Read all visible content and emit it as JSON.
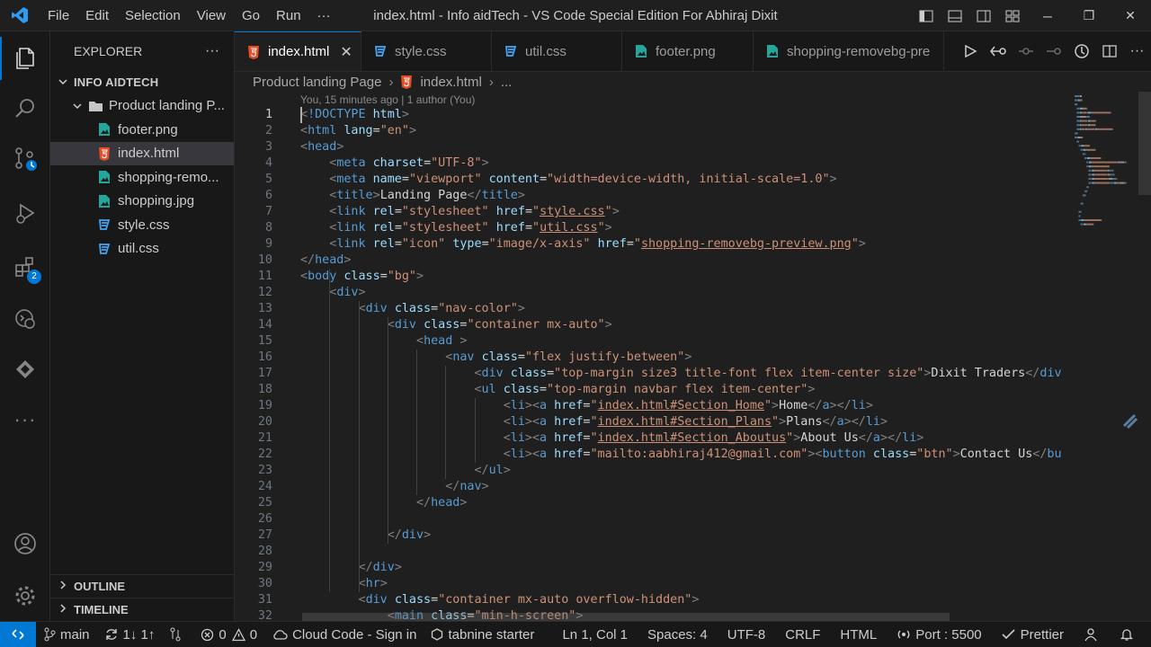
{
  "titlebar": {
    "menu": [
      "File",
      "Edit",
      "Selection",
      "View",
      "Go",
      "Run",
      "···"
    ],
    "title": "index.html - Info aidTech - VS Code Special Edition For Abhiraj Dixit"
  },
  "activitybar": {
    "scm_badge": "",
    "ext_badge": "2"
  },
  "sidebar": {
    "header": "EXPLORER",
    "more": "···",
    "project": "INFO AIDTECH",
    "folder": "Product landing P...",
    "files": [
      "footer.png",
      "index.html",
      "shopping-remo...",
      "shopping.jpg",
      "style.css",
      "util.css"
    ],
    "outline": "OUTLINE",
    "timeline": "TIMELINE"
  },
  "tabs": [
    {
      "label": "index.html",
      "close": "✕"
    },
    {
      "label": "style.css"
    },
    {
      "label": "util.css"
    },
    {
      "label": "footer.png"
    },
    {
      "label": "shopping-removebg-pre"
    }
  ],
  "breadcrumb": {
    "folder": "Product landing Page",
    "file": "index.html",
    "more": "..."
  },
  "codelens": "You, 15 minutes ago | 1 author (You)",
  "code_lines": [
    {
      "n": "1",
      "tokens": [
        [
          "t-br",
          "<"
        ],
        [
          "t-tag",
          "!DOCTYPE"
        ],
        [
          "t-txt",
          " "
        ],
        [
          "t-attr",
          "html"
        ],
        [
          "t-br",
          ">"
        ]
      ]
    },
    {
      "n": "2",
      "tokens": [
        [
          "t-br",
          "<"
        ],
        [
          "t-tag",
          "html"
        ],
        [
          "t-txt",
          " "
        ],
        [
          "t-attr",
          "lang"
        ],
        [
          "t-txt",
          "="
        ],
        [
          "t-str",
          "\"en\""
        ],
        [
          "t-br",
          ">"
        ]
      ]
    },
    {
      "n": "3",
      "tokens": [
        [
          "t-br",
          "<"
        ],
        [
          "t-tag",
          "head"
        ],
        [
          "t-br",
          ">"
        ]
      ]
    },
    {
      "n": "4",
      "tokens": [
        [
          "t-txt",
          "    "
        ],
        [
          "t-br",
          "<"
        ],
        [
          "t-tag",
          "meta"
        ],
        [
          "t-txt",
          " "
        ],
        [
          "t-attr",
          "charset"
        ],
        [
          "t-txt",
          "="
        ],
        [
          "t-str",
          "\"UTF-8\""
        ],
        [
          "t-br",
          ">"
        ]
      ]
    },
    {
      "n": "5",
      "tokens": [
        [
          "t-txt",
          "    "
        ],
        [
          "t-br",
          "<"
        ],
        [
          "t-tag",
          "meta"
        ],
        [
          "t-txt",
          " "
        ],
        [
          "t-attr",
          "name"
        ],
        [
          "t-txt",
          "="
        ],
        [
          "t-str",
          "\"viewport\""
        ],
        [
          "t-txt",
          " "
        ],
        [
          "t-attr",
          "content"
        ],
        [
          "t-txt",
          "="
        ],
        [
          "t-str",
          "\"width=device-width, initial-scale=1.0\""
        ],
        [
          "t-br",
          ">"
        ]
      ]
    },
    {
      "n": "6",
      "tokens": [
        [
          "t-txt",
          "    "
        ],
        [
          "t-br",
          "<"
        ],
        [
          "t-tag",
          "title"
        ],
        [
          "t-br",
          ">"
        ],
        [
          "t-txt",
          "Landing Page"
        ],
        [
          "t-br",
          "</"
        ],
        [
          "t-tag",
          "title"
        ],
        [
          "t-br",
          ">"
        ]
      ]
    },
    {
      "n": "7",
      "tokens": [
        [
          "t-txt",
          "    "
        ],
        [
          "t-br",
          "<"
        ],
        [
          "t-tag",
          "link"
        ],
        [
          "t-txt",
          " "
        ],
        [
          "t-attr",
          "rel"
        ],
        [
          "t-txt",
          "="
        ],
        [
          "t-str",
          "\"stylesheet\""
        ],
        [
          "t-txt",
          " "
        ],
        [
          "t-attr",
          "href"
        ],
        [
          "t-txt",
          "="
        ],
        [
          "t-str",
          "\""
        ],
        [
          "t-url",
          "style.css"
        ],
        [
          "t-str",
          "\""
        ],
        [
          "t-br",
          ">"
        ]
      ]
    },
    {
      "n": "8",
      "tokens": [
        [
          "t-txt",
          "    "
        ],
        [
          "t-br",
          "<"
        ],
        [
          "t-tag",
          "link"
        ],
        [
          "t-txt",
          " "
        ],
        [
          "t-attr",
          "rel"
        ],
        [
          "t-txt",
          "="
        ],
        [
          "t-str",
          "\"stylesheet\""
        ],
        [
          "t-txt",
          " "
        ],
        [
          "t-attr",
          "href"
        ],
        [
          "t-txt",
          "="
        ],
        [
          "t-str",
          "\""
        ],
        [
          "t-url",
          "util.css"
        ],
        [
          "t-str",
          "\""
        ],
        [
          "t-br",
          ">"
        ]
      ]
    },
    {
      "n": "9",
      "tokens": [
        [
          "t-txt",
          "    "
        ],
        [
          "t-br",
          "<"
        ],
        [
          "t-tag",
          "link"
        ],
        [
          "t-txt",
          " "
        ],
        [
          "t-attr",
          "rel"
        ],
        [
          "t-txt",
          "="
        ],
        [
          "t-str",
          "\"icon\""
        ],
        [
          "t-txt",
          " "
        ],
        [
          "t-attr",
          "type"
        ],
        [
          "t-txt",
          "="
        ],
        [
          "t-str",
          "\"image/x-axis\""
        ],
        [
          "t-txt",
          " "
        ],
        [
          "t-attr",
          "href"
        ],
        [
          "t-txt",
          "="
        ],
        [
          "t-str",
          "\""
        ],
        [
          "t-url",
          "shopping-removebg-preview.png"
        ],
        [
          "t-str",
          "\""
        ],
        [
          "t-br",
          ">"
        ]
      ]
    },
    {
      "n": "10",
      "tokens": [
        [
          "t-br",
          "</"
        ],
        [
          "t-tag",
          "head"
        ],
        [
          "t-br",
          ">"
        ]
      ]
    },
    {
      "n": "11",
      "tokens": [
        [
          "t-br",
          "<"
        ],
        [
          "t-tag",
          "body"
        ],
        [
          "t-txt",
          " "
        ],
        [
          "t-attr",
          "class"
        ],
        [
          "t-txt",
          "="
        ],
        [
          "t-str",
          "\"bg\""
        ],
        [
          "t-br",
          ">"
        ]
      ]
    },
    {
      "n": "12",
      "tokens": [
        [
          "t-txt",
          "    "
        ],
        [
          "t-br",
          "<"
        ],
        [
          "t-tag",
          "div"
        ],
        [
          "t-br",
          ">"
        ]
      ]
    },
    {
      "n": "13",
      "tokens": [
        [
          "t-txt",
          "        "
        ],
        [
          "t-br",
          "<"
        ],
        [
          "t-tag",
          "div"
        ],
        [
          "t-txt",
          " "
        ],
        [
          "t-attr",
          "class"
        ],
        [
          "t-txt",
          "="
        ],
        [
          "t-str",
          "\"nav-color\""
        ],
        [
          "t-br",
          ">"
        ]
      ]
    },
    {
      "n": "14",
      "tokens": [
        [
          "t-txt",
          "            "
        ],
        [
          "t-br",
          "<"
        ],
        [
          "t-tag",
          "div"
        ],
        [
          "t-txt",
          " "
        ],
        [
          "t-attr",
          "class"
        ],
        [
          "t-txt",
          "="
        ],
        [
          "t-str",
          "\"container mx-auto\""
        ],
        [
          "t-br",
          ">"
        ]
      ]
    },
    {
      "n": "15",
      "tokens": [
        [
          "t-txt",
          "                "
        ],
        [
          "t-br",
          "<"
        ],
        [
          "t-tag",
          "head"
        ],
        [
          "t-txt",
          " "
        ],
        [
          "t-br",
          ">"
        ]
      ]
    },
    {
      "n": "16",
      "tokens": [
        [
          "t-txt",
          "                    "
        ],
        [
          "t-br",
          "<"
        ],
        [
          "t-tag",
          "nav"
        ],
        [
          "t-txt",
          " "
        ],
        [
          "t-attr",
          "class"
        ],
        [
          "t-txt",
          "="
        ],
        [
          "t-str",
          "\"flex justify-between\""
        ],
        [
          "t-br",
          ">"
        ]
      ]
    },
    {
      "n": "17",
      "tokens": [
        [
          "t-txt",
          "                        "
        ],
        [
          "t-br",
          "<"
        ],
        [
          "t-tag",
          "div"
        ],
        [
          "t-txt",
          " "
        ],
        [
          "t-attr",
          "class"
        ],
        [
          "t-txt",
          "="
        ],
        [
          "t-str",
          "\"top-margin size3 title-font flex item-center size\""
        ],
        [
          "t-br",
          ">"
        ],
        [
          "t-txt",
          "Dixit Traders"
        ],
        [
          "t-br",
          "</"
        ],
        [
          "t-tag",
          "div"
        ]
      ]
    },
    {
      "n": "18",
      "tokens": [
        [
          "t-txt",
          "                        "
        ],
        [
          "t-br",
          "<"
        ],
        [
          "t-tag",
          "ul"
        ],
        [
          "t-txt",
          " "
        ],
        [
          "t-attr",
          "class"
        ],
        [
          "t-txt",
          "="
        ],
        [
          "t-str",
          "\"top-margin navbar flex item-center\""
        ],
        [
          "t-br",
          ">"
        ]
      ]
    },
    {
      "n": "19",
      "tokens": [
        [
          "t-txt",
          "                            "
        ],
        [
          "t-br",
          "<"
        ],
        [
          "t-tag",
          "li"
        ],
        [
          "t-br",
          "><"
        ],
        [
          "t-tag",
          "a"
        ],
        [
          "t-txt",
          " "
        ],
        [
          "t-attr",
          "href"
        ],
        [
          "t-txt",
          "="
        ],
        [
          "t-str",
          "\""
        ],
        [
          "t-url",
          "index.html#Section_Home"
        ],
        [
          "t-str",
          "\""
        ],
        [
          "t-br",
          ">"
        ],
        [
          "t-txt",
          "Home"
        ],
        [
          "t-br",
          "</"
        ],
        [
          "t-tag",
          "a"
        ],
        [
          "t-br",
          "></"
        ],
        [
          "t-tag",
          "li"
        ],
        [
          "t-br",
          ">"
        ]
      ]
    },
    {
      "n": "20",
      "tokens": [
        [
          "t-txt",
          "                            "
        ],
        [
          "t-br",
          "<"
        ],
        [
          "t-tag",
          "li"
        ],
        [
          "t-br",
          "><"
        ],
        [
          "t-tag",
          "a"
        ],
        [
          "t-txt",
          " "
        ],
        [
          "t-attr",
          "href"
        ],
        [
          "t-txt",
          "="
        ],
        [
          "t-str",
          "\""
        ],
        [
          "t-url",
          "index.html#Section_Plans"
        ],
        [
          "t-str",
          "\""
        ],
        [
          "t-br",
          ">"
        ],
        [
          "t-txt",
          "Plans"
        ],
        [
          "t-br",
          "</"
        ],
        [
          "t-tag",
          "a"
        ],
        [
          "t-br",
          "></"
        ],
        [
          "t-tag",
          "li"
        ],
        [
          "t-br",
          ">"
        ]
      ]
    },
    {
      "n": "21",
      "tokens": [
        [
          "t-txt",
          "                            "
        ],
        [
          "t-br",
          "<"
        ],
        [
          "t-tag",
          "li"
        ],
        [
          "t-br",
          "><"
        ],
        [
          "t-tag",
          "a"
        ],
        [
          "t-txt",
          " "
        ],
        [
          "t-attr",
          "href"
        ],
        [
          "t-txt",
          "="
        ],
        [
          "t-str",
          "\""
        ],
        [
          "t-url",
          "index.html#Section_Aboutus"
        ],
        [
          "t-str",
          "\""
        ],
        [
          "t-br",
          ">"
        ],
        [
          "t-txt",
          "About Us"
        ],
        [
          "t-br",
          "</"
        ],
        [
          "t-tag",
          "a"
        ],
        [
          "t-br",
          "></"
        ],
        [
          "t-tag",
          "li"
        ],
        [
          "t-br",
          ">"
        ]
      ]
    },
    {
      "n": "22",
      "tokens": [
        [
          "t-txt",
          "                            "
        ],
        [
          "t-br",
          "<"
        ],
        [
          "t-tag",
          "li"
        ],
        [
          "t-br",
          "><"
        ],
        [
          "t-tag",
          "a"
        ],
        [
          "t-txt",
          " "
        ],
        [
          "t-attr",
          "href"
        ],
        [
          "t-txt",
          "="
        ],
        [
          "t-str",
          "\"mailto:aabhiraj412@gmail.com\""
        ],
        [
          "t-br",
          "><"
        ],
        [
          "t-tag",
          "button"
        ],
        [
          "t-txt",
          " "
        ],
        [
          "t-attr",
          "class"
        ],
        [
          "t-txt",
          "="
        ],
        [
          "t-str",
          "\"btn\""
        ],
        [
          "t-br",
          ">"
        ],
        [
          "t-txt",
          "Contact Us"
        ],
        [
          "t-br",
          "</"
        ],
        [
          "t-tag",
          "bu"
        ]
      ]
    },
    {
      "n": "23",
      "tokens": [
        [
          "t-txt",
          "                        "
        ],
        [
          "t-br",
          "</"
        ],
        [
          "t-tag",
          "ul"
        ],
        [
          "t-br",
          ">"
        ]
      ]
    },
    {
      "n": "24",
      "tokens": [
        [
          "t-txt",
          "                    "
        ],
        [
          "t-br",
          "</"
        ],
        [
          "t-tag",
          "nav"
        ],
        [
          "t-br",
          ">"
        ]
      ]
    },
    {
      "n": "25",
      "tokens": [
        [
          "t-txt",
          "                "
        ],
        [
          "t-br",
          "</"
        ],
        [
          "t-tag",
          "head"
        ],
        [
          "t-br",
          ">"
        ]
      ]
    },
    {
      "n": "26",
      "tokens": []
    },
    {
      "n": "27",
      "tokens": [
        [
          "t-txt",
          "            "
        ],
        [
          "t-br",
          "</"
        ],
        [
          "t-tag",
          "div"
        ],
        [
          "t-br",
          ">"
        ]
      ]
    },
    {
      "n": "28",
      "tokens": []
    },
    {
      "n": "29",
      "tokens": [
        [
          "t-txt",
          "        "
        ],
        [
          "t-br",
          "</"
        ],
        [
          "t-tag",
          "div"
        ],
        [
          "t-br",
          ">"
        ]
      ]
    },
    {
      "n": "30",
      "tokens": [
        [
          "t-txt",
          "        "
        ],
        [
          "t-br",
          "<"
        ],
        [
          "t-tag",
          "hr"
        ],
        [
          "t-br",
          ">"
        ]
      ]
    },
    {
      "n": "31",
      "tokens": [
        [
          "t-txt",
          "        "
        ],
        [
          "t-br",
          "<"
        ],
        [
          "t-tag",
          "div"
        ],
        [
          "t-txt",
          " "
        ],
        [
          "t-attr",
          "class"
        ],
        [
          "t-txt",
          "="
        ],
        [
          "t-str",
          "\"container mx-auto overflow-hidden\""
        ],
        [
          "t-br",
          ">"
        ]
      ]
    },
    {
      "n": "32",
      "tokens": [
        [
          "t-txt",
          "            "
        ],
        [
          "t-br",
          "<"
        ],
        [
          "t-tag",
          "main"
        ],
        [
          "t-txt",
          " "
        ],
        [
          "t-attr",
          "class"
        ],
        [
          "t-txt",
          "="
        ],
        [
          "t-str",
          "\"min-h-screen\""
        ],
        [
          "t-br",
          ">"
        ]
      ]
    }
  ],
  "statusbar": {
    "branch": "main",
    "sync": "1↓ 1↑",
    "errors": "0",
    "warnings": "0",
    "cloud": "Cloud Code - Sign in",
    "tabnine": "tabnine starter",
    "position": "Ln 1, Col 1",
    "spaces": "Spaces: 4",
    "encoding": "UTF-8",
    "eol": "CRLF",
    "language": "HTML",
    "port": "Port : 5500",
    "prettier": "Prettier"
  },
  "colors": {
    "accent": "#0078d4",
    "html_icon": "#e44d26",
    "css_icon": "#42a5f5",
    "image_icon": "#26a69a"
  }
}
